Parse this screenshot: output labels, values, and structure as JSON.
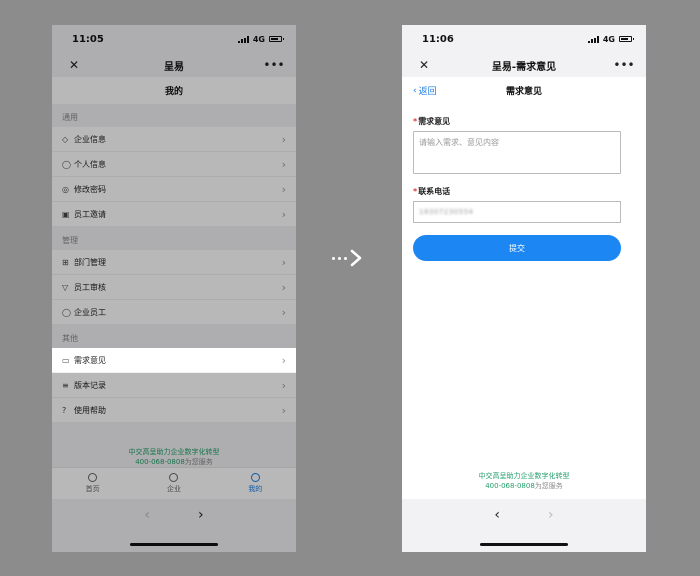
{
  "time": "11:05",
  "time_right": "11:06",
  "network": "4G",
  "left": {
    "nav_title": "呈易",
    "sub_title": "我的",
    "sections": [
      {
        "label": "通用",
        "items": [
          {
            "icon": "diamond-icon",
            "glyph": "◇",
            "label": "企业信息"
          },
          {
            "icon": "person-icon",
            "glyph": "◯",
            "label": "个人信息"
          },
          {
            "icon": "key-icon",
            "glyph": "◎",
            "label": "修改密码"
          },
          {
            "icon": "invite-icon",
            "glyph": "▣",
            "label": "员工邀请"
          }
        ]
      },
      {
        "label": "管理",
        "items": [
          {
            "icon": "org-chart-icon",
            "glyph": "⊞",
            "label": "部门管理"
          },
          {
            "icon": "filter-icon",
            "glyph": "▽",
            "label": "员工审核"
          },
          {
            "icon": "person-icon",
            "glyph": "◯",
            "label": "企业员工"
          }
        ]
      },
      {
        "label": "其他",
        "items": [
          {
            "icon": "message-icon",
            "glyph": "▭",
            "label": "需求意见"
          },
          {
            "icon": "list-icon",
            "glyph": "≡",
            "label": "版本记录"
          },
          {
            "icon": "help-icon",
            "glyph": "?",
            "label": "使用帮助"
          }
        ]
      }
    ],
    "slogan_line1": "中交高呈助力企业数字化转型",
    "slogan_phone": "400-068-0808",
    "slogan_tail": "为您服务",
    "tabs": [
      {
        "label": "首页"
      },
      {
        "label": "企业"
      },
      {
        "label": "我的"
      }
    ]
  },
  "right": {
    "nav_title": "呈易-需求意见",
    "back_label": "返回",
    "sub_title": "需求意见",
    "field1_label": "需求意见",
    "field1_placeholder": "请输入需求、意见内容",
    "field2_label": "联系电话",
    "field2_value": "18307230554",
    "submit_label": "提交",
    "slogan_line1": "中交高呈助力企业数字化转型",
    "slogan_phone": "400-068-0808",
    "slogan_tail": "为您服务"
  },
  "colors": {
    "accent": "#1c86f2",
    "link": "#1c7de8",
    "slogan": "#25a06b",
    "required": "#e03b3b"
  }
}
